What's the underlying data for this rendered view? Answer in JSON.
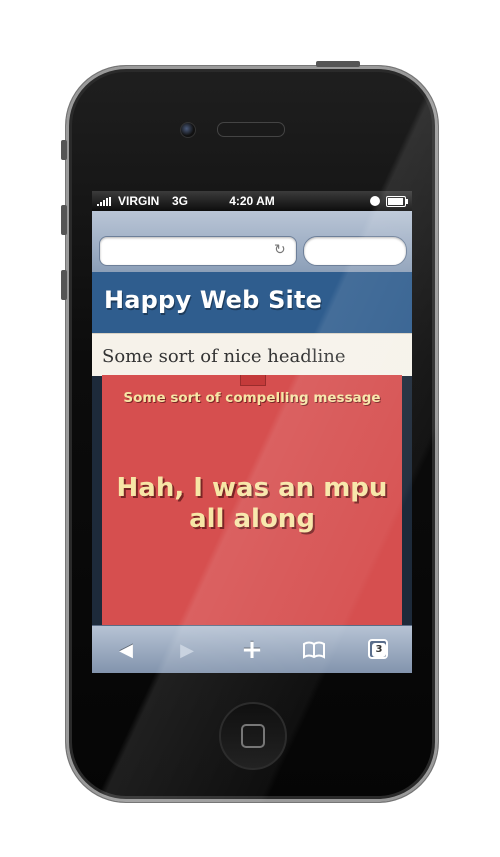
{
  "status_bar": {
    "carrier": "VIRGIN",
    "network": "3G",
    "time": "4:20 AM"
  },
  "browser": {
    "address_placeholder": "",
    "search_placeholder": ""
  },
  "site": {
    "title": "Happy Web Site",
    "headline": "Some sort of nice headline"
  },
  "mpu": {
    "message": "Some sort of compelling message",
    "main_text": "Hah, I was an mpu all along",
    "background_color": "#d64f4f",
    "text_color": "#f7e6a6"
  },
  "toolbar": {
    "pages_count": "3"
  },
  "icons": {
    "back": "back-icon",
    "forward": "forward-icon",
    "add": "add-icon",
    "bookmarks": "bookmarks-icon",
    "pages": "pages-icon"
  }
}
